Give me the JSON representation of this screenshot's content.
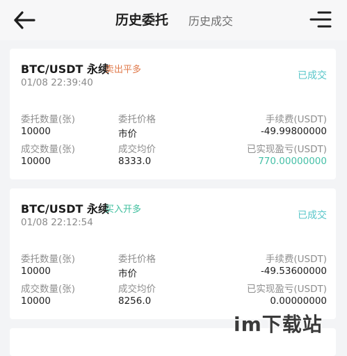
{
  "header": {
    "active_tab": "历史委托",
    "inactive_tab": "历史成交",
    "back_icon": "arrow-left-icon",
    "menu_icon": "filter-lines-icon"
  },
  "orders": [
    {
      "pair": "BTC/USDT 永续",
      "tag": "卖出平多",
      "time": "01/08 22:39:40",
      "status": "已成交",
      "order_qty_label": "委托数量(张)",
      "order_qty": "10000",
      "order_price_label": "委托价格",
      "order_price": "市价",
      "fee_label": "手续费(USDT)",
      "fee": "-49.99800000",
      "filled_qty_label": "成交数量(张)",
      "filled_qty": "10000",
      "avg_price_label": "成交均价",
      "avg_price": "8333.0",
      "pnl_label": "已实现盈亏(USDT)",
      "pnl": "770.00000000"
    },
    {
      "pair": "BTC/USDT 永续",
      "tag": "买入开多",
      "time": "01/08 22:12:54",
      "status": "已成交",
      "order_qty_label": "委托数量(张)",
      "order_qty": "10000",
      "order_price_label": "委托价格",
      "order_price": "市价",
      "fee_label": "手续费(USDT)",
      "fee": "-49.53600000",
      "filled_qty_label": "成交数量(张)",
      "filled_qty": "10000",
      "avg_price_label": "成交均价",
      "avg_price": "8256.0",
      "pnl_label": "已实现盈亏(USDT)",
      "pnl": "0.00000000"
    }
  ],
  "watermark": "im下载站",
  "colors": {
    "sell_tag": "#e0794a",
    "buy_tag": "#3fbf9e",
    "status": "#58c6c9",
    "profit": "#45c0a7"
  }
}
